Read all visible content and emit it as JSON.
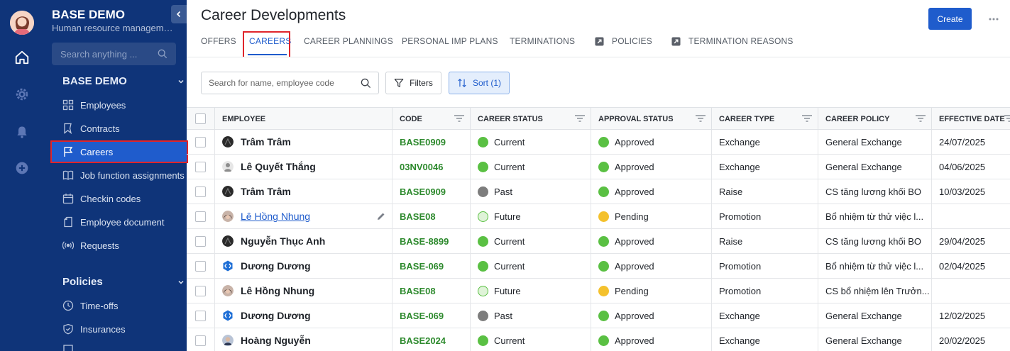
{
  "colors": {
    "sidebar": "#0f3479",
    "accent": "#1f5ccc",
    "highlight": "#e0252b",
    "code": "#2e8a2e",
    "status_green": "#5ac043",
    "status_gray": "#7d7d7d",
    "status_future": "#dff3d8",
    "status_pending": "#f4c12d"
  },
  "rail": {
    "icons": [
      "home-icon",
      "settings-icon",
      "bell-icon",
      "plus-circle-icon"
    ]
  },
  "sidebar": {
    "title": "BASE DEMO",
    "subtitle": "Human resource management",
    "search_placeholder": "Search anything ...",
    "sections": [
      {
        "title": "BASE DEMO",
        "items": [
          {
            "label": "Employees",
            "icon": "grid-icon"
          },
          {
            "label": "Contracts",
            "icon": "bookmark-icon"
          },
          {
            "label": "Careers",
            "icon": "flag-icon",
            "active": true
          },
          {
            "label": "Job function assignments",
            "icon": "book-icon"
          },
          {
            "label": "Checkin codes",
            "icon": "calendar-icon"
          },
          {
            "label": "Employee document",
            "icon": "document-icon"
          },
          {
            "label": "Requests",
            "icon": "broadcast-icon"
          }
        ]
      },
      {
        "title": "Policies",
        "items": [
          {
            "label": "Time-offs",
            "icon": "clock-icon"
          },
          {
            "label": "Insurances",
            "icon": "shield-icon"
          }
        ]
      }
    ]
  },
  "header": {
    "title": "Career Developments",
    "create_label": "Create",
    "tabs": [
      {
        "label": "OFFERS"
      },
      {
        "label": "CAREERS",
        "active": true
      },
      {
        "label": "CAREER PLANNINGS"
      },
      {
        "label": "PERSONAL IMP PLANS"
      },
      {
        "label": "TERMINATIONS"
      },
      {
        "label": "POLICIES",
        "icon": "external-link-icon"
      },
      {
        "label": "TERMINATION REASONS",
        "icon": "external-link-icon"
      }
    ]
  },
  "toolbar": {
    "search_placeholder": "Search for name, employee code",
    "filters_label": "Filters",
    "sort_label": "Sort (1)"
  },
  "table": {
    "columns": [
      "EMPLOYEE",
      "CODE",
      "CAREER STATUS",
      "APPROVAL STATUS",
      "CAREER TYPE",
      "CAREER POLICY",
      "EFFECTIVE DATE"
    ],
    "rows": [
      {
        "employee": "Trâm Trâm",
        "code": "BASE0909",
        "career_status": "Current",
        "approval_status": "Approved",
        "career_type": "Exchange",
        "career_policy": "General Exchange",
        "effective_date": "24/07/2025",
        "avatar": "dark"
      },
      {
        "employee": "Lê Quyết Thắng",
        "code": "03NV0046",
        "career_status": "Current",
        "approval_status": "Approved",
        "career_type": "Exchange",
        "career_policy": "General Exchange",
        "effective_date": "04/06/2025",
        "avatar": "gray"
      },
      {
        "employee": "Trâm Trâm",
        "code": "BASE0909",
        "career_status": "Past",
        "approval_status": "Approved",
        "career_type": "Raise",
        "career_policy": "CS tăng lương khối BO",
        "effective_date": "10/03/2025",
        "avatar": "dark"
      },
      {
        "employee": "Lê Hồng Nhung",
        "code": "BASE08",
        "career_status": "Future",
        "approval_status": "Pending",
        "career_type": "Promotion",
        "career_policy": "Bổ nhiệm từ thử việc l...",
        "effective_date": "",
        "avatar": "photo",
        "link": true
      },
      {
        "employee": "Nguyễn Thục Anh",
        "code": "BASE-8899",
        "career_status": "Current",
        "approval_status": "Approved",
        "career_type": "Raise",
        "career_policy": "CS tăng lương khối BO",
        "effective_date": "29/04/2025",
        "avatar": "dark"
      },
      {
        "employee": "Dương Dương",
        "code": "BASE-069",
        "career_status": "Current",
        "approval_status": "Approved",
        "career_type": "Promotion",
        "career_policy": "Bổ nhiệm từ thử việc l...",
        "effective_date": "02/04/2025",
        "avatar": "hex"
      },
      {
        "employee": "Lê Hồng Nhung",
        "code": "BASE08",
        "career_status": "Future",
        "approval_status": "Pending",
        "career_type": "Promotion",
        "career_policy": "CS bổ nhiệm lên Trưởn...",
        "effective_date": "",
        "avatar": "photo"
      },
      {
        "employee": "Dương Dương",
        "code": "BASE-069",
        "career_status": "Past",
        "approval_status": "Approved",
        "career_type": "Exchange",
        "career_policy": "General Exchange",
        "effective_date": "12/02/2025",
        "avatar": "hex"
      },
      {
        "employee": "Hoàng Nguyễn",
        "code": "BASE2024",
        "career_status": "Current",
        "approval_status": "Approved",
        "career_type": "Exchange",
        "career_policy": "General Exchange",
        "effective_date": "20/02/2025",
        "avatar": "photo2"
      }
    ]
  }
}
